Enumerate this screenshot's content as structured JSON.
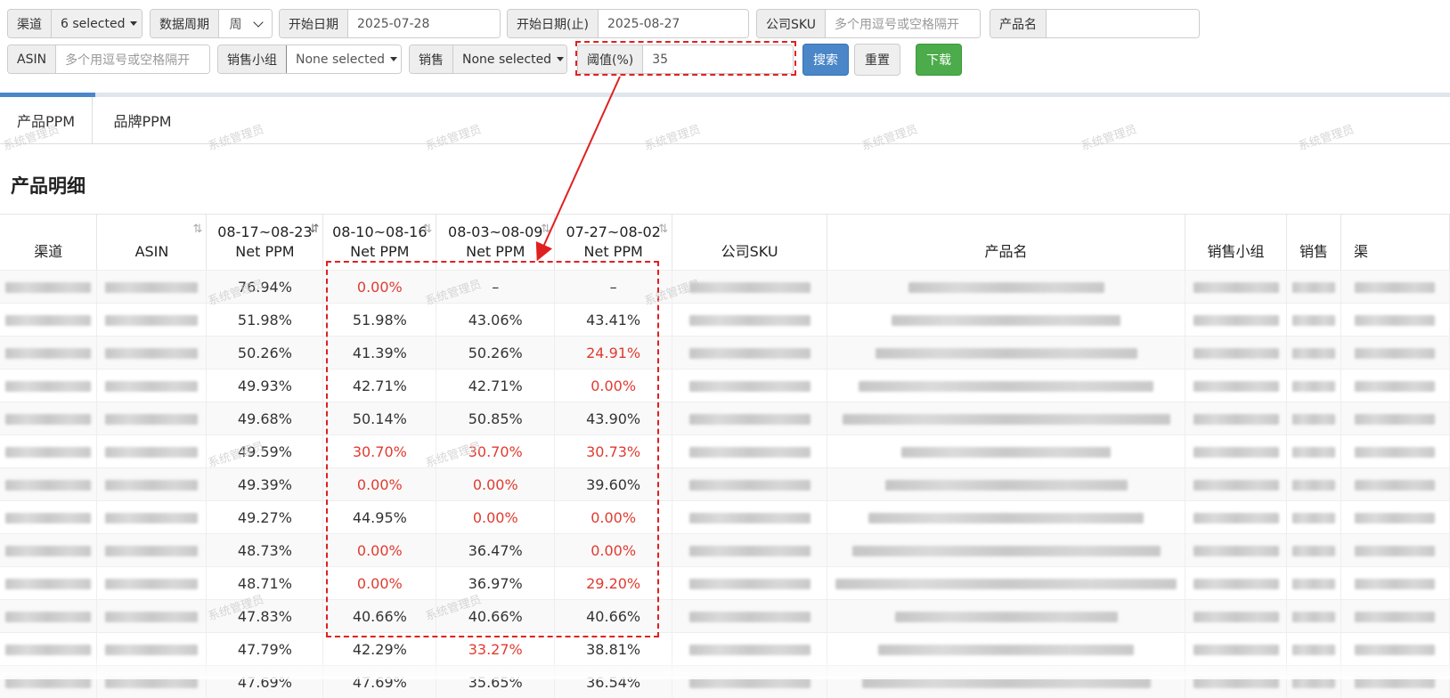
{
  "filters": {
    "channel_label": "渠道",
    "channel_value": "6 selected",
    "period_label": "数据周期",
    "period_value": "周",
    "start_label": "开始日期",
    "start_value": "2025-07-28",
    "end_label": "开始日期(止)",
    "end_value": "2025-08-27",
    "sku_label": "公司SKU",
    "sku_placeholder": "多个用逗号或空格隔开",
    "product_label": "产品名",
    "asin_label": "ASIN",
    "asin_placeholder": "多个用逗号或空格隔开",
    "sales_group_label": "销售小组",
    "sales_group_value": "None selected",
    "sales_label": "销售",
    "sales_value": "None selected",
    "threshold_label": "阈值(%)",
    "threshold_value": "35",
    "search_label": "搜索",
    "reset_label": "重置",
    "download_label": "下载"
  },
  "tabs": [
    {
      "label": "产品PPM"
    },
    {
      "label": "品牌PPM"
    }
  ],
  "section_title": "产品明细",
  "watermark": "系统管理员",
  "table": {
    "headers": {
      "channel": "渠道",
      "asin": "ASIN",
      "w1_date": "08-17~08-23",
      "w2_date": "08-10~08-16",
      "w3_date": "08-03~08-09",
      "w4_date": "07-27~08-02",
      "metric": "Net PPM",
      "sku": "公司SKU",
      "product": "产品名",
      "sales_group": "销售小组",
      "sales": "销售",
      "channel2": "渠"
    },
    "rows": [
      {
        "w1": "76.94%",
        "w2": "0.00%",
        "w3": "–",
        "w4": "–"
      },
      {
        "w1": "51.98%",
        "w2": "51.98%",
        "w3": "43.06%",
        "w4": "43.41%"
      },
      {
        "w1": "50.26%",
        "w2": "41.39%",
        "w3": "50.26%",
        "w4": "24.91%"
      },
      {
        "w1": "49.93%",
        "w2": "42.71%",
        "w3": "42.71%",
        "w4": "0.00%"
      },
      {
        "w1": "49.68%",
        "w2": "50.14%",
        "w3": "50.85%",
        "w4": "43.90%"
      },
      {
        "w1": "49.59%",
        "w2": "30.70%",
        "w3": "30.70%",
        "w4": "30.73%"
      },
      {
        "w1": "49.39%",
        "w2": "0.00%",
        "w3": "0.00%",
        "w4": "39.60%"
      },
      {
        "w1": "49.27%",
        "w2": "44.95%",
        "w3": "0.00%",
        "w4": "0.00%"
      },
      {
        "w1": "48.73%",
        "w2": "0.00%",
        "w3": "36.47%",
        "w4": "0.00%"
      },
      {
        "w1": "48.71%",
        "w2": "0.00%",
        "w3": "36.97%",
        "w4": "29.20%"
      },
      {
        "w1": "47.83%",
        "w2": "40.66%",
        "w3": "40.66%",
        "w4": "40.66%"
      },
      {
        "w1": "47.79%",
        "w2": "42.29%",
        "w3": "33.27%",
        "w4": "38.81%"
      },
      {
        "w1": "47.69%",
        "w2": "47.69%",
        "w3": "35.65%",
        "w4": "36.54%"
      }
    ]
  }
}
